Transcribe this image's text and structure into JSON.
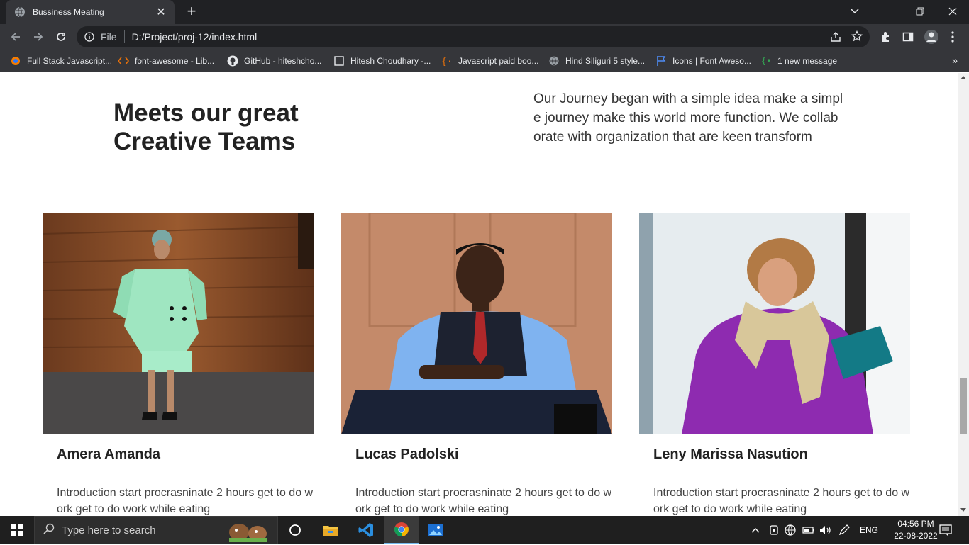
{
  "browser": {
    "tab_title": "Bussiness Meating",
    "tab_close": "✕",
    "new_tab": "+",
    "omnibox_scheme": "File",
    "url": "D:/Project/proj-12/index.html",
    "bookmarks": [
      {
        "label": "Full Stack Javascript...",
        "icon": "orange-circle-icon"
      },
      {
        "label": "font-awesome - Lib...",
        "icon": "code-brackets-icon"
      },
      {
        "label": "GitHub - hiteshcho...",
        "icon": "github-icon"
      },
      {
        "label": "Hitesh Choudhary -...",
        "icon": "square-icon"
      },
      {
        "label": "Javascript paid boo...",
        "icon": "curly-brackets-icon"
      },
      {
        "label": "Hind Siliguri 5 style...",
        "icon": "globe-icon"
      },
      {
        "label": "Icons | Font Aweso...",
        "icon": "flag-icon"
      },
      {
        "label": "1 new message",
        "icon": "chat-icon"
      }
    ],
    "bookmarks_more": "»"
  },
  "page": {
    "heading": "Meets our great Creative Teams",
    "intro": "Our Journey began with a simple idea make a simple journey make this world more function. We collaborate with organization that are keen transform",
    "team": [
      {
        "name": "Amera Amanda",
        "desc": "Introduction start procrasninate 2 hours get to do work get to do work while eating",
        "photo": "woman in mint suit against wood wall"
      },
      {
        "name": "Lucas Padolski",
        "desc": "Introduction start procrasninate 2 hours get to do work get to do work while eating",
        "photo": "man in vest and blue shirt seated"
      },
      {
        "name": "Leny Marissa Nasution",
        "desc": "Introduction start procrasninate 2 hours get to do work get to do work while eating",
        "photo": "woman in purple dress holding folder"
      }
    ]
  },
  "taskbar": {
    "search_placeholder": "Type here to search",
    "language": "ENG",
    "time": "04:56 PM",
    "date": "22-08-2022"
  },
  "colors": {
    "chrome_dark": "#202124",
    "chrome_mid": "#35363a",
    "text_light": "#e8eaed",
    "heading": "#222222",
    "taskbar": "#1f1f1f"
  }
}
